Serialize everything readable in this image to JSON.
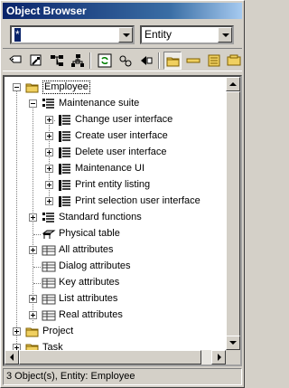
{
  "window": {
    "title": "Object Browser"
  },
  "filters": {
    "name_filter_value": "*",
    "type_filter_value": "Entity"
  },
  "toolbar": {
    "buttons": [
      {
        "name": "tag-icon"
      },
      {
        "name": "find-icon"
      },
      {
        "name": "hierarchy-icon"
      },
      {
        "name": "network-icon"
      },
      {
        "name": "refresh-icon"
      },
      {
        "name": "link-icon"
      },
      {
        "name": "move-icon"
      },
      {
        "name": "folder-view-icon"
      },
      {
        "name": "field-view-icon"
      },
      {
        "name": "list-view-icon"
      },
      {
        "name": "class-view-icon"
      }
    ]
  },
  "tree": {
    "items": [
      {
        "label": "Employee",
        "icon": "folder-icon"
      },
      {
        "label": "Maintenance suite",
        "icon": "suite-icon"
      },
      {
        "label": "Change user interface",
        "icon": "function-icon"
      },
      {
        "label": "Create user interface",
        "icon": "function-icon"
      },
      {
        "label": "Delete user interface",
        "icon": "function-icon"
      },
      {
        "label": "Maintenance UI",
        "icon": "function-icon"
      },
      {
        "label": "Print entity listing",
        "icon": "function-icon"
      },
      {
        "label": "Print selection user interface",
        "icon": "function-icon"
      },
      {
        "label": "Standard functions",
        "icon": "suite-icon"
      },
      {
        "label": "Physical table",
        "icon": "table-icon"
      },
      {
        "label": "All attributes",
        "icon": "attributes-icon"
      },
      {
        "label": "Dialog attributes",
        "icon": "attributes-icon"
      },
      {
        "label": "Key attributes",
        "icon": "attributes-icon"
      },
      {
        "label": "List attributes",
        "icon": "attributes-icon"
      },
      {
        "label": "Real attributes",
        "icon": "attributes-icon"
      },
      {
        "label": "Project",
        "icon": "folder-icon"
      },
      {
        "label": "Task",
        "icon": "folder-icon"
      }
    ]
  },
  "status": {
    "text": "3 Object(s), Entity: Employee"
  }
}
